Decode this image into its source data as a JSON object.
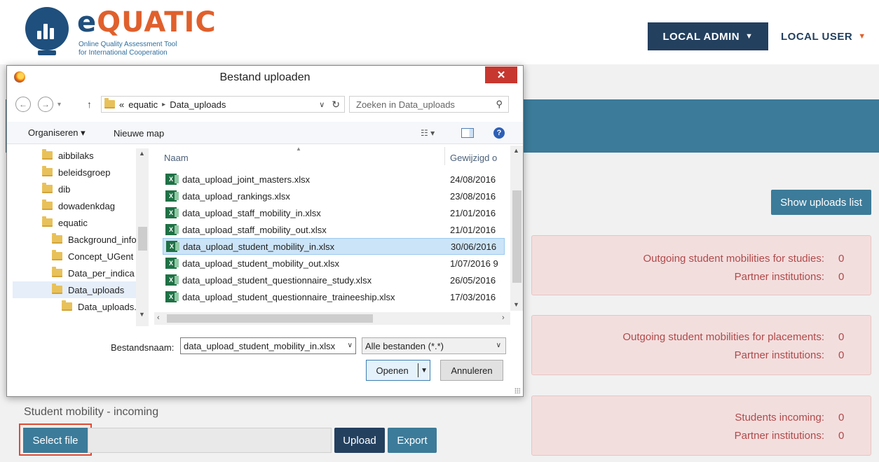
{
  "brand": {
    "name_first": "e",
    "name_rest": "QUATIC",
    "subtitle_line1": "Online Quality Assessment Tool",
    "subtitle_line2": "for International Cooperation"
  },
  "header": {
    "admin_label": "LOCAL ADMIN",
    "user_label": "LOCAL USER",
    "caret": "▼"
  },
  "right_panel": {
    "show_uploads_label": "Show uploads list",
    "boxes": [
      {
        "label1": "Outgoing student mobilities for studies:",
        "value1": "0",
        "label2": "Partner institutions:",
        "value2": "0"
      },
      {
        "label1": "Outgoing student mobilities for placements:",
        "value1": "0",
        "label2": "Partner institutions:",
        "value2": "0"
      },
      {
        "label1": "Students incoming:",
        "value1": "0",
        "label2": "Partner institutions:",
        "value2": "0"
      }
    ]
  },
  "upload_section": {
    "title": "Student mobility - incoming",
    "select_file_label": "Select file",
    "upload_label": "Upload",
    "export_label": "Export"
  },
  "dialog": {
    "title": "Bestand uploaden",
    "close_glyph": "✕",
    "address": {
      "overflow": "«",
      "path": [
        "equatic",
        "Data_uploads"
      ]
    },
    "search_placeholder": "Zoeken in Data_uploads",
    "toolbar": {
      "organize_label": "Organiseren ▾",
      "new_folder_label": "Nieuwe map"
    },
    "tree": [
      {
        "label": "aibbilaks",
        "indent": 0
      },
      {
        "label": "beleidsgroep",
        "indent": 0
      },
      {
        "label": "dib",
        "indent": 0
      },
      {
        "label": "dowadenkdag",
        "indent": 0
      },
      {
        "label": "equatic",
        "indent": 0
      },
      {
        "label": "Background_info",
        "indent": 1
      },
      {
        "label": "Concept_UGent",
        "indent": 1
      },
      {
        "label": "Data_per_indica",
        "indent": 1
      },
      {
        "label": "Data_uploads",
        "indent": 1,
        "selected": true
      },
      {
        "label": "Data_uploads.zip",
        "indent": 2
      }
    ],
    "columns": {
      "name": "Naam",
      "date": "Gewijzigd o"
    },
    "files": [
      {
        "name": "data_upload_joint_masters.xlsx",
        "date": "24/08/2016"
      },
      {
        "name": "data_upload_rankings.xlsx",
        "date": "23/08/2016"
      },
      {
        "name": "data_upload_staff_mobility_in.xlsx",
        "date": "21/01/2016"
      },
      {
        "name": "data_upload_staff_mobility_out.xlsx",
        "date": "21/01/2016"
      },
      {
        "name": "data_upload_student_mobility_in.xlsx",
        "date": "30/06/2016",
        "selected": true
      },
      {
        "name": "data_upload_student_mobility_out.xlsx",
        "date": "1/07/2016 9"
      },
      {
        "name": "data_upload_student_questionnaire_study.xlsx",
        "date": "26/05/2016"
      },
      {
        "name": "data_upload_student_questionnaire_traineeship.xlsx",
        "date": "17/03/2016"
      }
    ],
    "filename_label": "Bestandsnaam:",
    "filename_value": "data_upload_student_mobility_in.xlsx",
    "filter_value": "Alle bestanden (*.*)",
    "open_label": "Openen",
    "cancel_label": "Annuleren"
  },
  "colors": {
    "navy": "#23405f",
    "teal": "#3c7b99",
    "orange": "#e0602c",
    "alert_bg": "#f3dede",
    "alert_text": "#b04a4a",
    "highlight": "#e04a32"
  }
}
